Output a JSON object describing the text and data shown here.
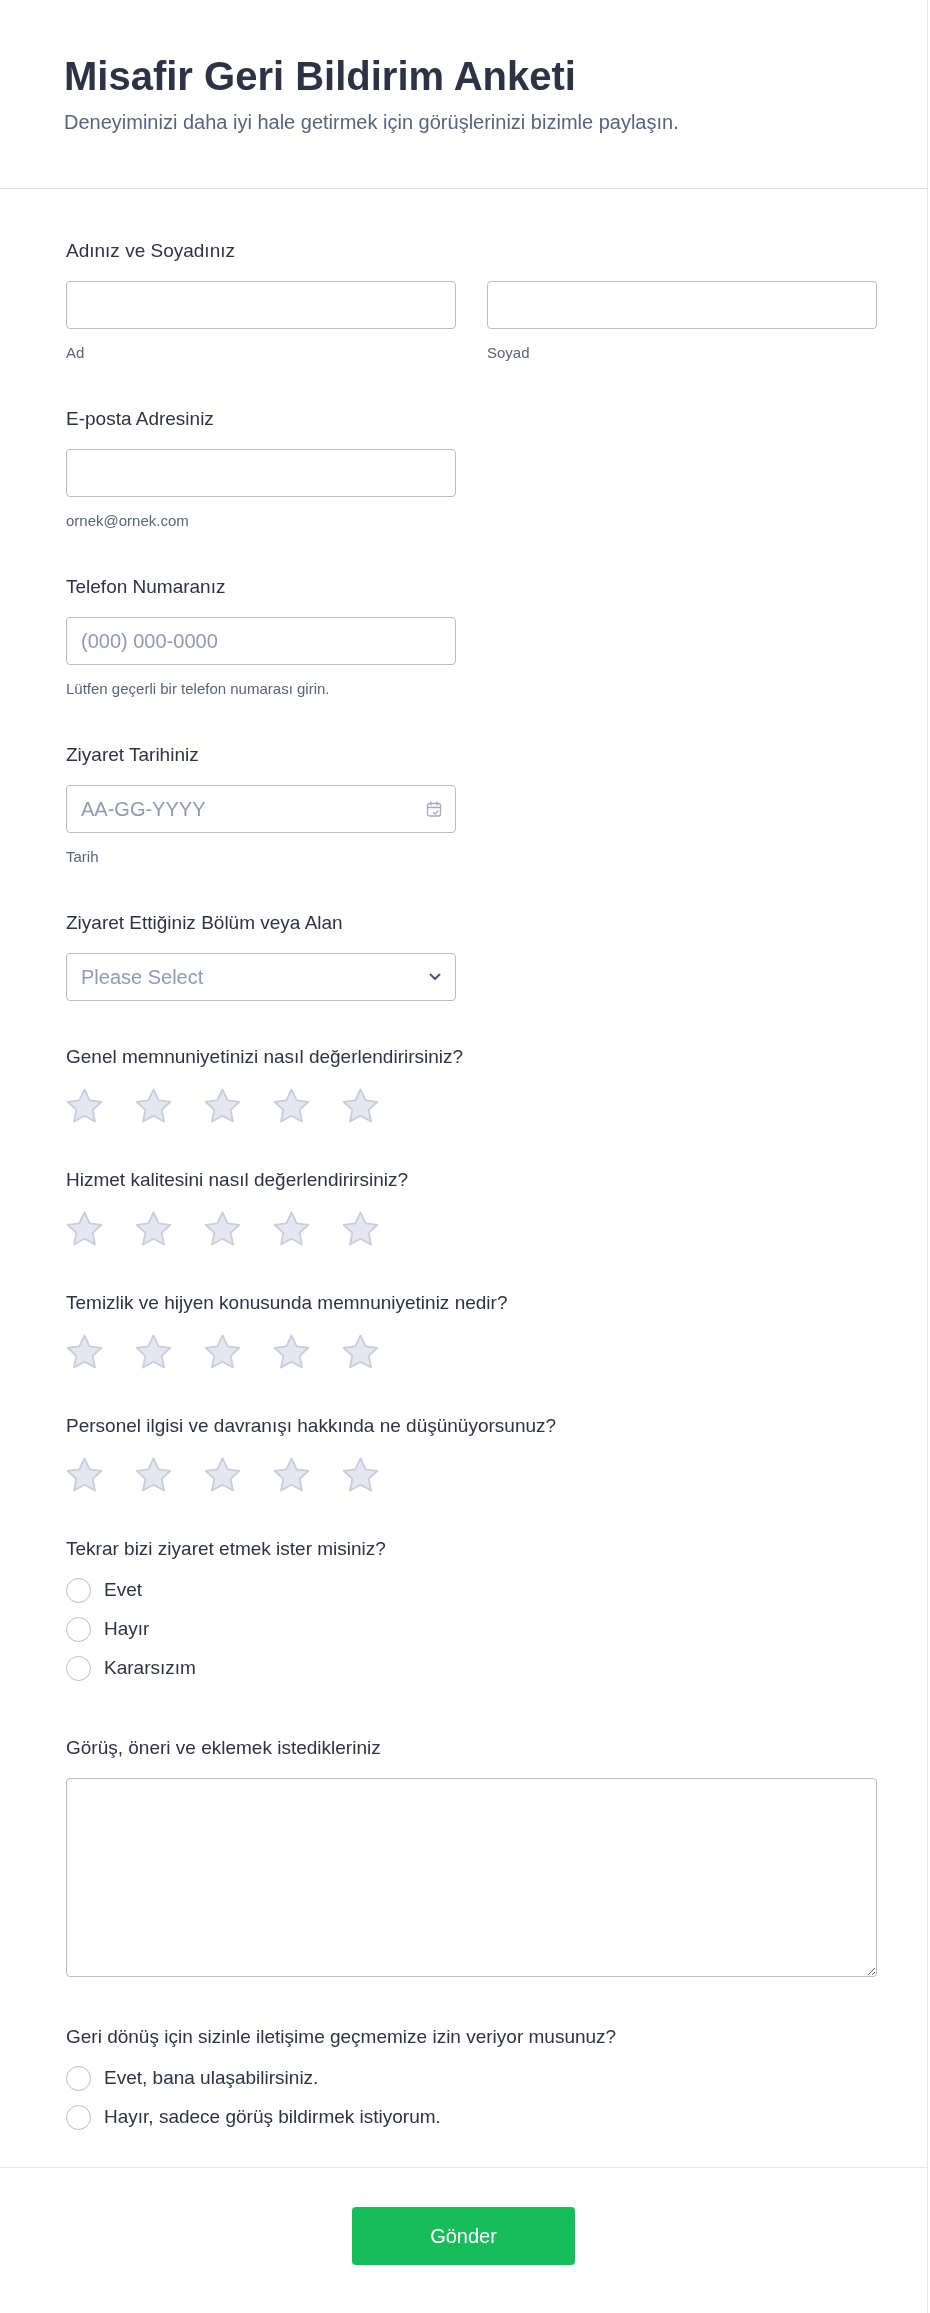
{
  "header": {
    "title": "Misafir Geri Bildirim Anketi",
    "subtitle": "Deneyiminizi daha iyi hale getirmek için görüşlerinizi bizimle paylaşın."
  },
  "fields": [
    {
      "kind": "fullname",
      "label": "Adınız ve Soyadınız",
      "inputs": [
        {
          "sublabel": "Ad"
        },
        {
          "sublabel": "Soyad"
        }
      ]
    },
    {
      "kind": "text",
      "label": "E-posta Adresiniz",
      "sublabel": "ornek@ornek.com"
    },
    {
      "kind": "text",
      "label": "Telefon Numaranız",
      "placeholder": "(000) 000-0000",
      "sublabel": "Lütfen geçerli bir telefon numarası girin."
    },
    {
      "kind": "date",
      "label": "Ziyaret Tarihiniz",
      "placeholder": "AA-GG-YYYY",
      "sublabel": "Tarih"
    },
    {
      "kind": "select",
      "label": "Ziyaret Ettiğiniz Bölüm veya Alan",
      "placeholder": "Please Select"
    },
    {
      "kind": "rating",
      "label": "Genel memnuniyetinizi nasıl değerlendirirsiniz?",
      "stars": 0
    },
    {
      "kind": "rating",
      "label": "Hizmet kalitesini nasıl değerlendirirsiniz?",
      "stars": 0
    },
    {
      "kind": "rating",
      "label": "Temizlik ve hijyen konusunda memnuniyetiniz nedir?",
      "stars": 0
    },
    {
      "kind": "rating",
      "label": "Personel ilgisi ve davranışı hakkında ne düşünüyorsunuz?",
      "stars": 0
    },
    {
      "kind": "radio",
      "label": "Tekrar bizi ziyaret etmek ister misiniz?",
      "options": [
        {
          "label": "Evet",
          "selected": false
        },
        {
          "label": "Hayır",
          "selected": false
        },
        {
          "label": "Kararsızım",
          "selected": false
        }
      ]
    },
    {
      "kind": "textarea",
      "label": "Görüş, öneri ve eklemek istedikleriniz"
    },
    {
      "kind": "radio",
      "label": "Geri dönüş için sizinle iletişime geçmemize izin veriyor musunuz?",
      "options": [
        {
          "label": "Evet, bana ulaşabilirsiniz.",
          "selected": false
        },
        {
          "label": "Hayır, sadece görüş bildirmek istiyorum.",
          "selected": false
        }
      ]
    }
  ],
  "submit": {
    "label": "Gönder"
  }
}
